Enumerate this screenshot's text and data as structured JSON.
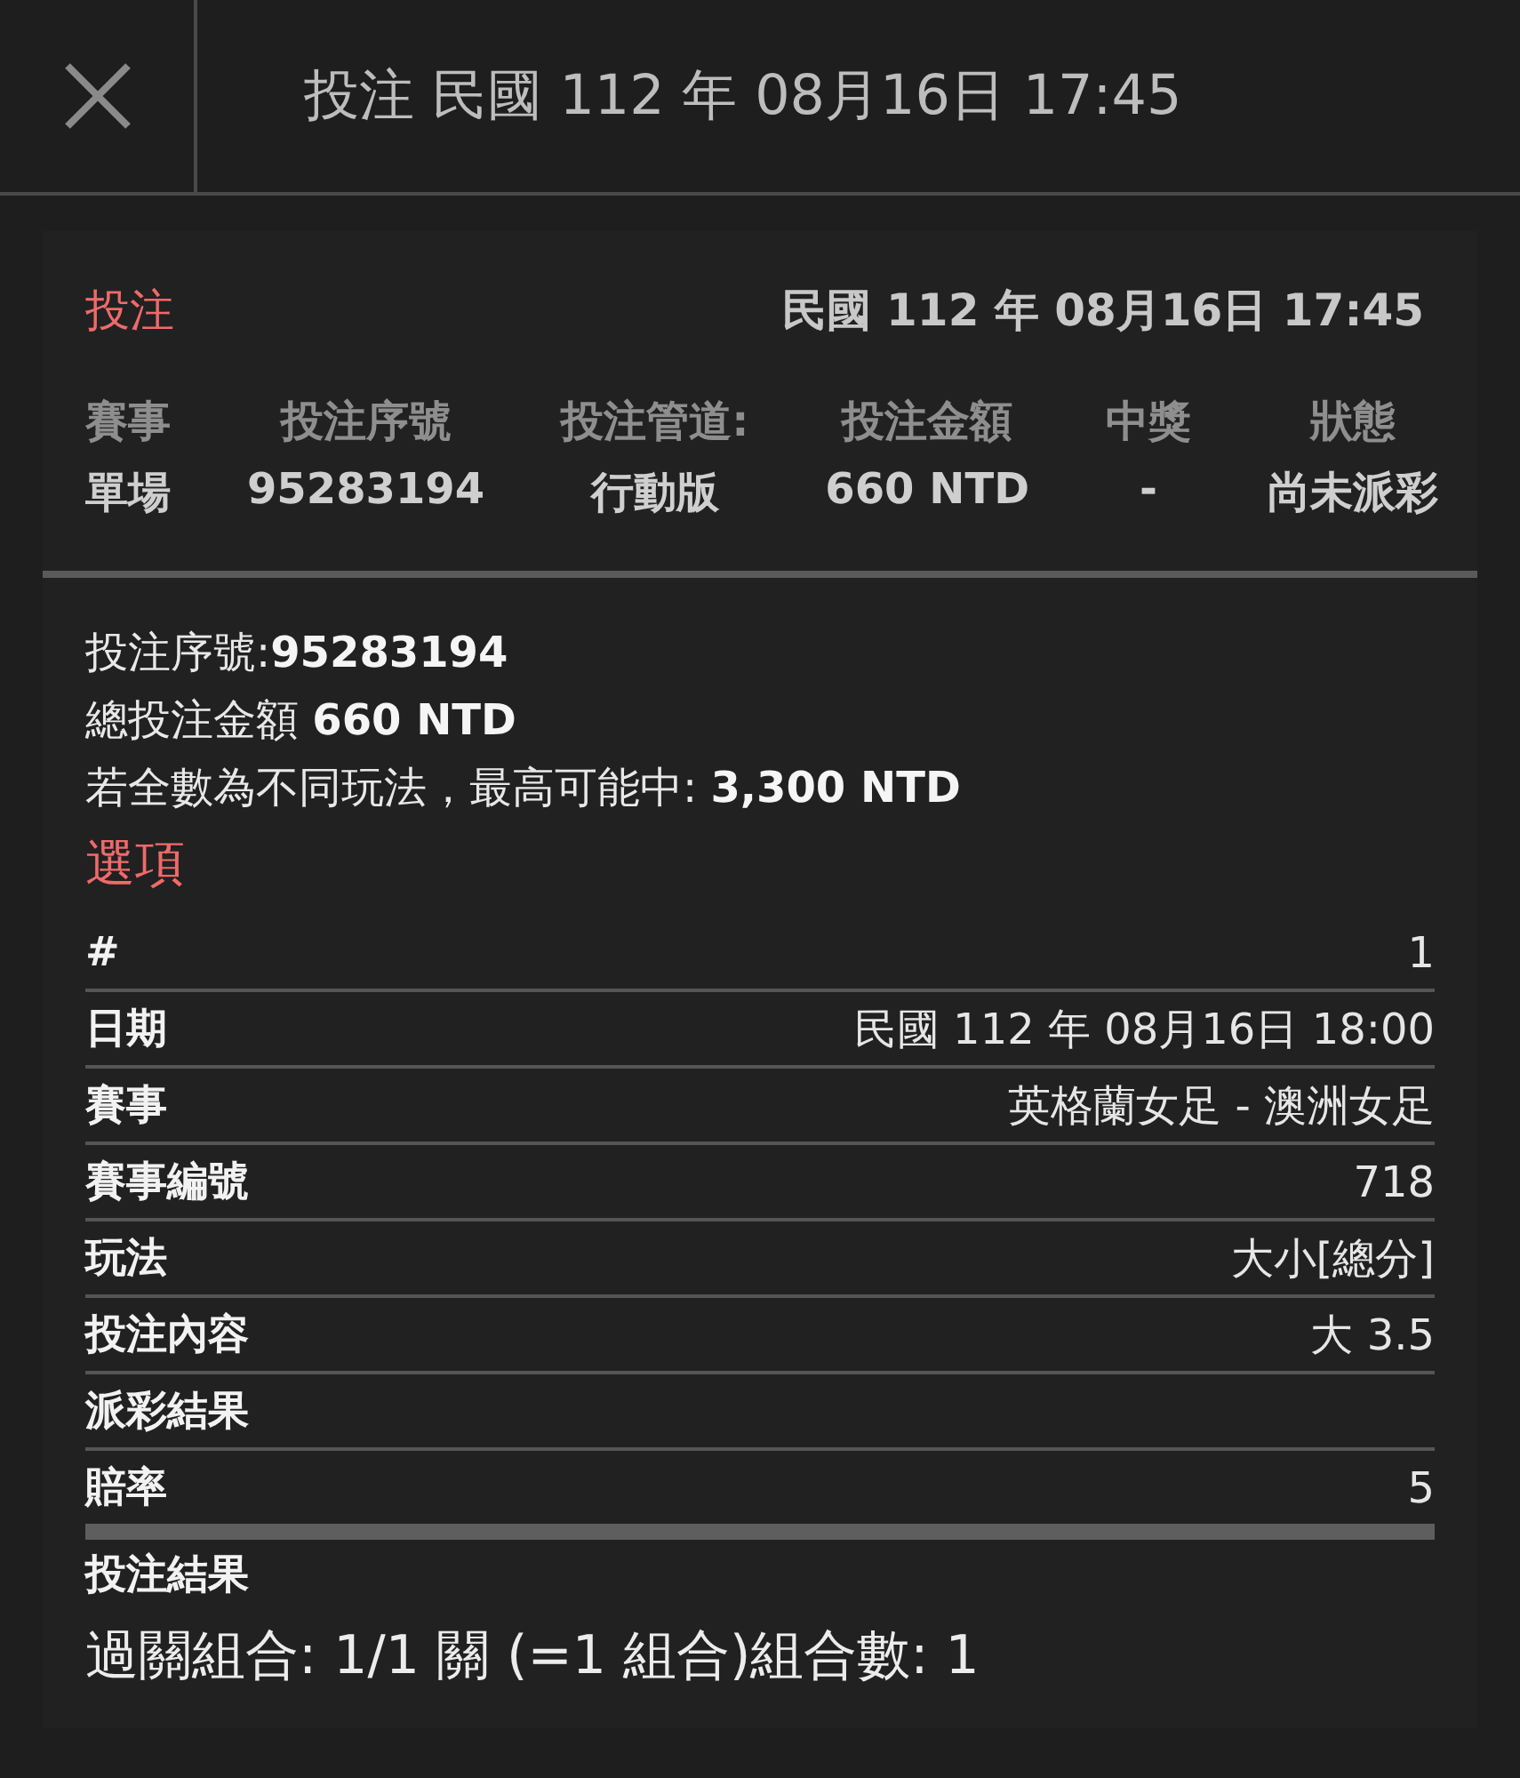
{
  "header": {
    "title": "投注 民國 112 年 08月16日 17:45"
  },
  "bet": {
    "heading": "投注",
    "datetime": "民國 112 年 08月16日 17:45",
    "summary": [
      {
        "label": "賽事",
        "value": "單場"
      },
      {
        "label": "投注序號",
        "value": "95283194"
      },
      {
        "label": "投注管道:",
        "value": "行動版"
      },
      {
        "label": "投注金額",
        "value": "660 NTD"
      },
      {
        "label": "中獎",
        "value": "-"
      },
      {
        "label": "狀態",
        "value": "尚未派彩"
      }
    ],
    "info": [
      "投注序號:**95283194**",
      "總投注金額 **660 NTD**",
      "若全數為不同玩法，最高可能中: **3,300 NTD**"
    ]
  },
  "selections": {
    "heading": "選項",
    "rows": [
      {
        "label": "#",
        "value": "1"
      },
      {
        "label": "日期",
        "value": "民國 112 年 08月16日 18:00"
      },
      {
        "label": "賽事",
        "value": "英格蘭女足 - 澳洲女足"
      },
      {
        "label": "賽事編號",
        "value": "718"
      },
      {
        "label": "玩法",
        "value": "大小[總分]"
      },
      {
        "label": "投注內容",
        "value": "大 3.5"
      },
      {
        "label": "派彩結果"
      },
      {
        "label": "賠率",
        "value": "5"
      }
    ]
  },
  "result": {
    "heading": "投注結果",
    "combination": "過關組合: 1/1 關 (=1 組合)組合數: 1"
  }
}
